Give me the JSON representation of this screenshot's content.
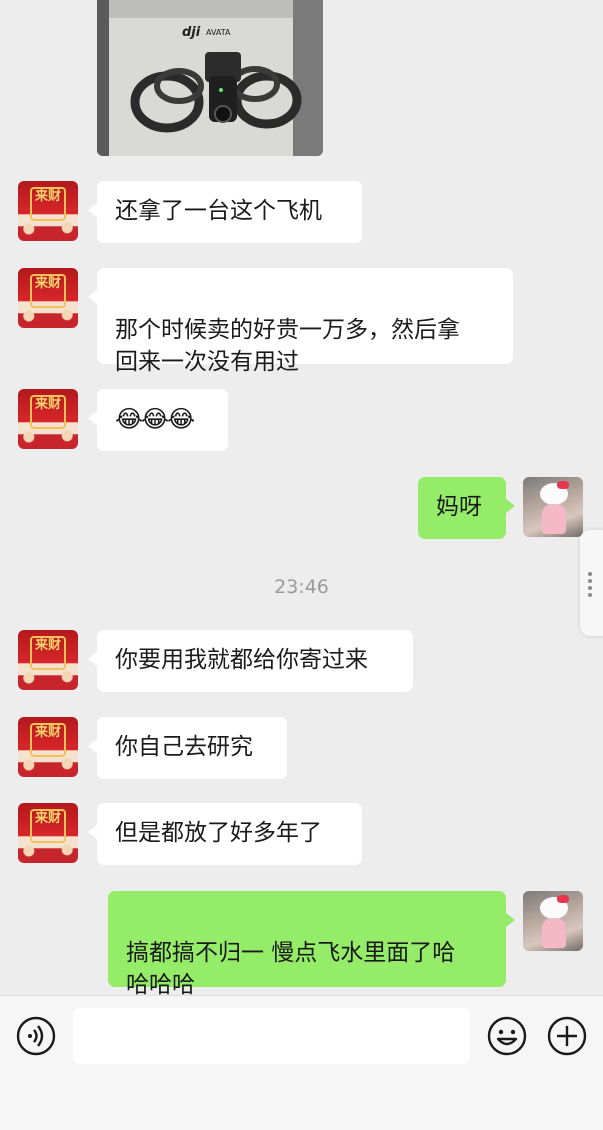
{
  "conversation": {
    "timestamp": "23:46",
    "messages_before": [
      {
        "from": "other",
        "text": "还拿了一台这个飞机"
      },
      {
        "from": "other",
        "text": "那个时候卖的好贵一万多，然后拿\n回来一次没有用过"
      },
      {
        "from": "other",
        "text": "😂😂😂"
      },
      {
        "from": "self",
        "text": "妈呀"
      }
    ],
    "messages_after": [
      {
        "from": "other",
        "text": "你要用我就都给你寄过来"
      },
      {
        "from": "other",
        "text": "你自己去研究"
      },
      {
        "from": "other",
        "text": "但是都放了好多年了"
      },
      {
        "from": "self",
        "text": "搞都搞不归一 慢点飞水里面了哈\n哈哈哈"
      }
    ],
    "photo": {
      "brand": "dji",
      "product": "AVATA"
    }
  },
  "avatars": {
    "other": {
      "glyph": "来财"
    }
  },
  "input_bar": {
    "placeholder": "",
    "icons": [
      "voice-icon",
      "emoji-icon",
      "plus-icon"
    ]
  },
  "colors": {
    "background": "#ededed",
    "bubble_self": "#95ec69",
    "bubble_other": "#ffffff"
  }
}
